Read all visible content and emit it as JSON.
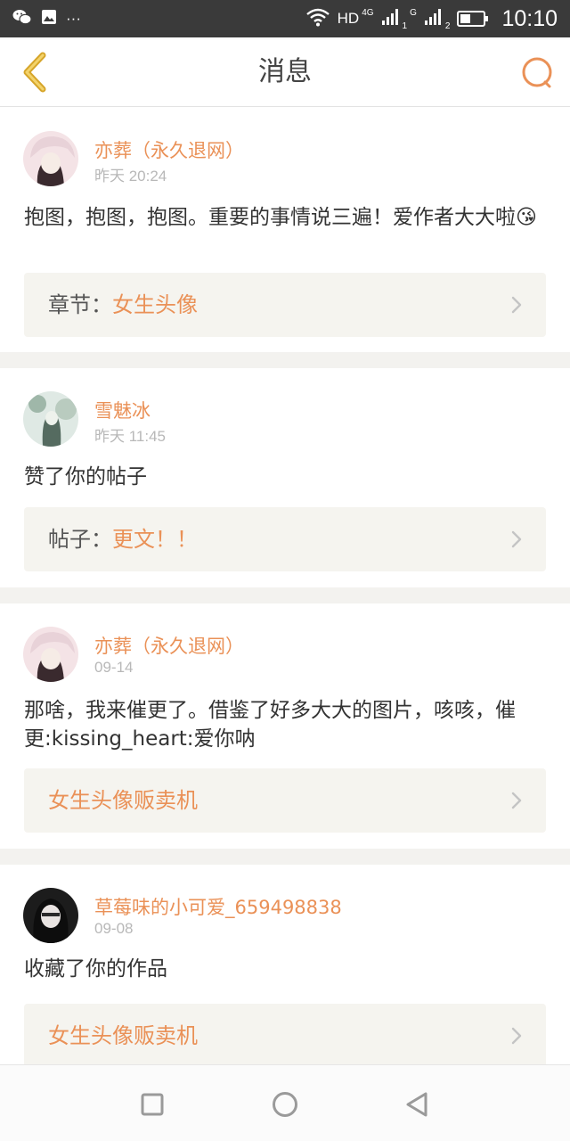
{
  "status_bar": {
    "icons": [
      "wechat-icon",
      "gallery-icon",
      "more-dots-icon",
      "wifi-icon",
      "signal-icon",
      "battery-icon"
    ],
    "more": "···",
    "hd": "HD",
    "net1": "4G",
    "net2": "G",
    "sim1": "1",
    "sim2": "2",
    "time": "10:10"
  },
  "header": {
    "title": "消息",
    "back_icon": "chevron-left-icon",
    "search_icon": "search-icon"
  },
  "colors": {
    "accent": "#ea9157",
    "back": "#d6a52a",
    "text": "#333333",
    "muted": "#b8b8b8",
    "ref_bg": "#f5f4ef"
  },
  "messages": [
    {
      "user": "亦葬（永久退网）",
      "time": "昨天 20:24",
      "text": "抱图，抱图，抱图。重要的事情说三遍！爱作者大大啦😘",
      "ref_label": "章节：",
      "ref_value": "女生头像"
    },
    {
      "user": "雪魅冰",
      "time": "昨天 11:45",
      "text": "赞了你的帖子",
      "ref_label": "帖子：",
      "ref_value": "更文！！"
    },
    {
      "user": "亦葬（永久退网）",
      "time": "09-14",
      "text": "那啥，我来催更了。借鉴了好多大大的图片，咳咳，催更:kissing_heart:爱你呐",
      "ref_label": "",
      "ref_value": "女生头像贩卖机"
    },
    {
      "user": "草莓味的小可爱_659498838",
      "time": "09-08",
      "text": "收藏了你的作品",
      "ref_label": "",
      "ref_value": "女生头像贩卖机"
    }
  ],
  "nav_bar": {
    "icons": [
      "square-recents-icon",
      "circle-home-icon",
      "triangle-back-icon"
    ]
  }
}
